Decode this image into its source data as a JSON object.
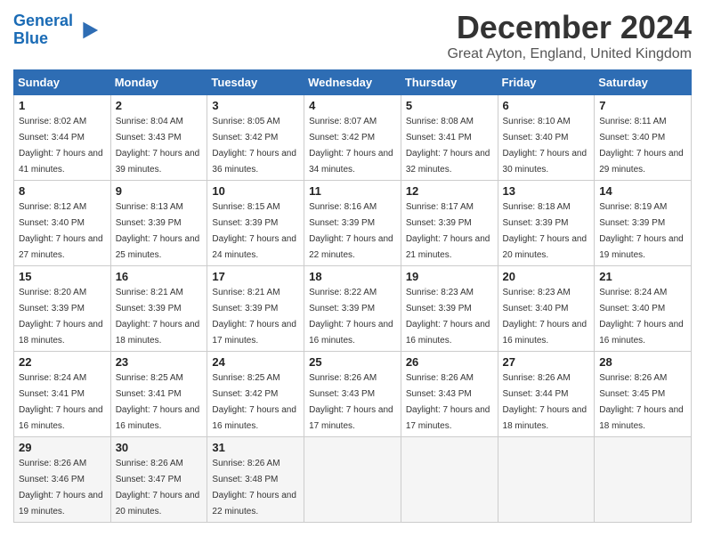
{
  "header": {
    "logo_line1": "General",
    "logo_line2": "Blue",
    "month_title": "December 2024",
    "location": "Great Ayton, England, United Kingdom"
  },
  "days_of_week": [
    "Sunday",
    "Monday",
    "Tuesday",
    "Wednesday",
    "Thursday",
    "Friday",
    "Saturday"
  ],
  "weeks": [
    [
      {
        "day": "1",
        "sunrise": "8:02 AM",
        "sunset": "3:44 PM",
        "daylight": "7 hours and 41 minutes."
      },
      {
        "day": "2",
        "sunrise": "8:04 AM",
        "sunset": "3:43 PM",
        "daylight": "7 hours and 39 minutes."
      },
      {
        "day": "3",
        "sunrise": "8:05 AM",
        "sunset": "3:42 PM",
        "daylight": "7 hours and 36 minutes."
      },
      {
        "day": "4",
        "sunrise": "8:07 AM",
        "sunset": "3:42 PM",
        "daylight": "7 hours and 34 minutes."
      },
      {
        "day": "5",
        "sunrise": "8:08 AM",
        "sunset": "3:41 PM",
        "daylight": "7 hours and 32 minutes."
      },
      {
        "day": "6",
        "sunrise": "8:10 AM",
        "sunset": "3:40 PM",
        "daylight": "7 hours and 30 minutes."
      },
      {
        "day": "7",
        "sunrise": "8:11 AM",
        "sunset": "3:40 PM",
        "daylight": "7 hours and 29 minutes."
      }
    ],
    [
      {
        "day": "8",
        "sunrise": "8:12 AM",
        "sunset": "3:40 PM",
        "daylight": "7 hours and 27 minutes."
      },
      {
        "day": "9",
        "sunrise": "8:13 AM",
        "sunset": "3:39 PM",
        "daylight": "7 hours and 25 minutes."
      },
      {
        "day": "10",
        "sunrise": "8:15 AM",
        "sunset": "3:39 PM",
        "daylight": "7 hours and 24 minutes."
      },
      {
        "day": "11",
        "sunrise": "8:16 AM",
        "sunset": "3:39 PM",
        "daylight": "7 hours and 22 minutes."
      },
      {
        "day": "12",
        "sunrise": "8:17 AM",
        "sunset": "3:39 PM",
        "daylight": "7 hours and 21 minutes."
      },
      {
        "day": "13",
        "sunrise": "8:18 AM",
        "sunset": "3:39 PM",
        "daylight": "7 hours and 20 minutes."
      },
      {
        "day": "14",
        "sunrise": "8:19 AM",
        "sunset": "3:39 PM",
        "daylight": "7 hours and 19 minutes."
      }
    ],
    [
      {
        "day": "15",
        "sunrise": "8:20 AM",
        "sunset": "3:39 PM",
        "daylight": "7 hours and 18 minutes."
      },
      {
        "day": "16",
        "sunrise": "8:21 AM",
        "sunset": "3:39 PM",
        "daylight": "7 hours and 18 minutes."
      },
      {
        "day": "17",
        "sunrise": "8:21 AM",
        "sunset": "3:39 PM",
        "daylight": "7 hours and 17 minutes."
      },
      {
        "day": "18",
        "sunrise": "8:22 AM",
        "sunset": "3:39 PM",
        "daylight": "7 hours and 16 minutes."
      },
      {
        "day": "19",
        "sunrise": "8:23 AM",
        "sunset": "3:39 PM",
        "daylight": "7 hours and 16 minutes."
      },
      {
        "day": "20",
        "sunrise": "8:23 AM",
        "sunset": "3:40 PM",
        "daylight": "7 hours and 16 minutes."
      },
      {
        "day": "21",
        "sunrise": "8:24 AM",
        "sunset": "3:40 PM",
        "daylight": "7 hours and 16 minutes."
      }
    ],
    [
      {
        "day": "22",
        "sunrise": "8:24 AM",
        "sunset": "3:41 PM",
        "daylight": "7 hours and 16 minutes."
      },
      {
        "day": "23",
        "sunrise": "8:25 AM",
        "sunset": "3:41 PM",
        "daylight": "7 hours and 16 minutes."
      },
      {
        "day": "24",
        "sunrise": "8:25 AM",
        "sunset": "3:42 PM",
        "daylight": "7 hours and 16 minutes."
      },
      {
        "day": "25",
        "sunrise": "8:26 AM",
        "sunset": "3:43 PM",
        "daylight": "7 hours and 17 minutes."
      },
      {
        "day": "26",
        "sunrise": "8:26 AM",
        "sunset": "3:43 PM",
        "daylight": "7 hours and 17 minutes."
      },
      {
        "day": "27",
        "sunrise": "8:26 AM",
        "sunset": "3:44 PM",
        "daylight": "7 hours and 18 minutes."
      },
      {
        "day": "28",
        "sunrise": "8:26 AM",
        "sunset": "3:45 PM",
        "daylight": "7 hours and 18 minutes."
      }
    ],
    [
      {
        "day": "29",
        "sunrise": "8:26 AM",
        "sunset": "3:46 PM",
        "daylight": "7 hours and 19 minutes."
      },
      {
        "day": "30",
        "sunrise": "8:26 AM",
        "sunset": "3:47 PM",
        "daylight": "7 hours and 20 minutes."
      },
      {
        "day": "31",
        "sunrise": "8:26 AM",
        "sunset": "3:48 PM",
        "daylight": "7 hours and 22 minutes."
      },
      null,
      null,
      null,
      null
    ]
  ]
}
